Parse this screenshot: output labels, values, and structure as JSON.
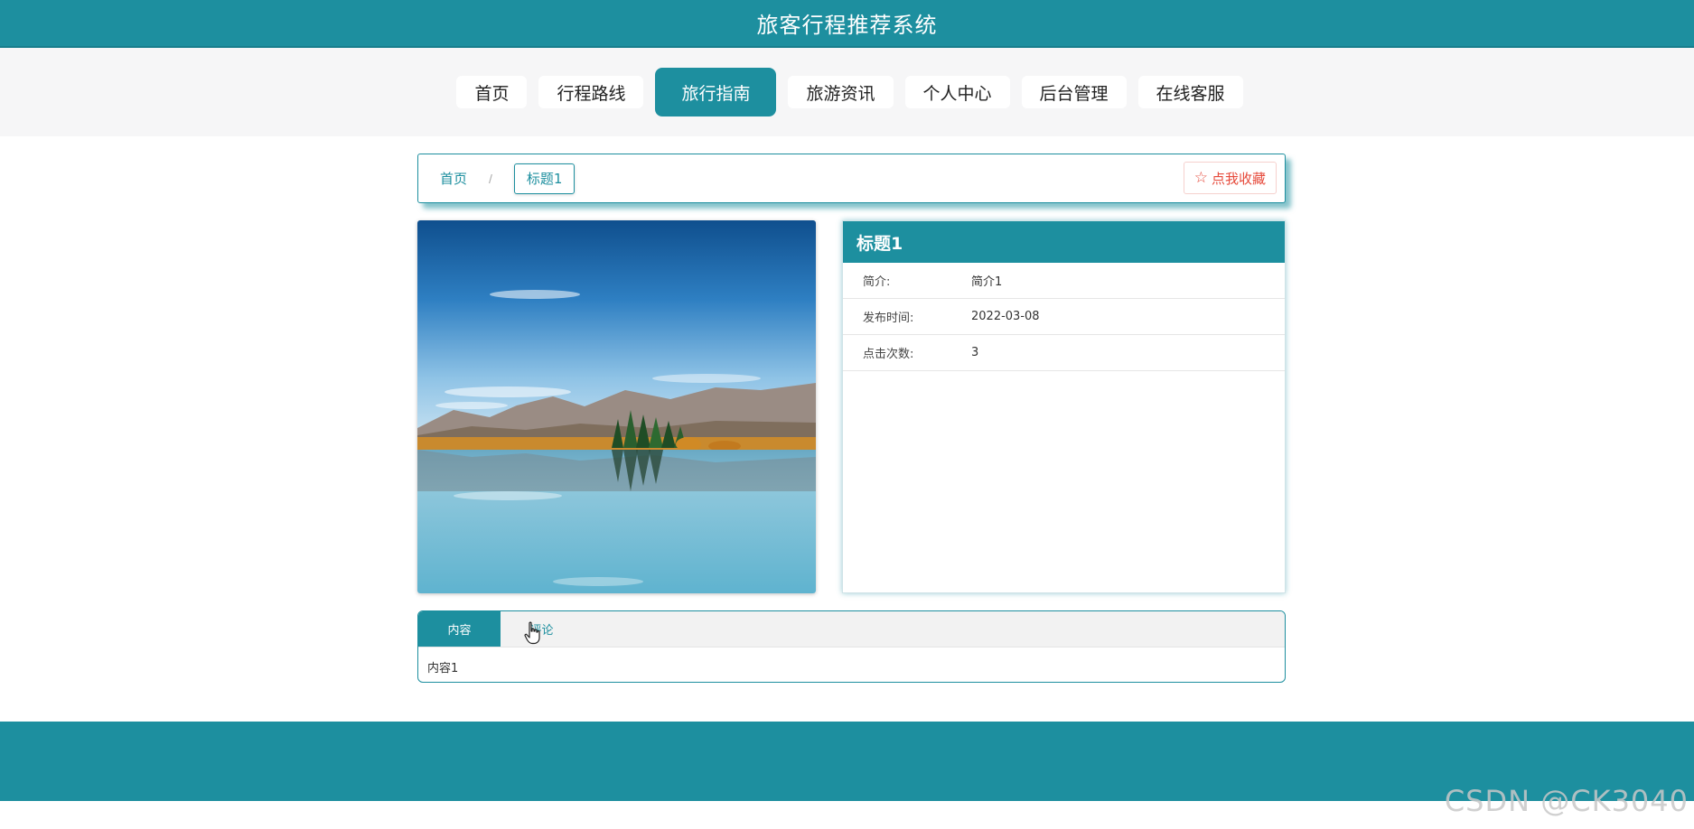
{
  "site": {
    "title": "旅客行程推荐系统"
  },
  "nav": {
    "items": [
      {
        "label": "首页"
      },
      {
        "label": "行程路线"
      },
      {
        "label": "旅行指南"
      },
      {
        "label": "旅游资讯"
      },
      {
        "label": "个人中心"
      },
      {
        "label": "后台管理"
      },
      {
        "label": "在线客服"
      }
    ],
    "active": "旅行指南"
  },
  "breadcrumb": {
    "home": "首页",
    "separator": "/",
    "current": "标题1"
  },
  "favorite": {
    "icon": "star-outline-icon",
    "label": "点我收藏"
  },
  "detail": {
    "title": "标题1",
    "fields": [
      {
        "key": "简介:",
        "value": "简介1"
      },
      {
        "key": "发布时间:",
        "value": "2022-03-08"
      },
      {
        "key": "点击次数:",
        "value": "3"
      }
    ]
  },
  "tabs": {
    "items": [
      {
        "label": "内容"
      },
      {
        "label": "评论"
      }
    ],
    "active": "内容",
    "content": "内容1"
  },
  "watermark": "CSDN @CK3040",
  "colors": {
    "primary": "#1d8f9f",
    "favorite": "#e64a3b",
    "nav_band": "#f6f6f7"
  }
}
